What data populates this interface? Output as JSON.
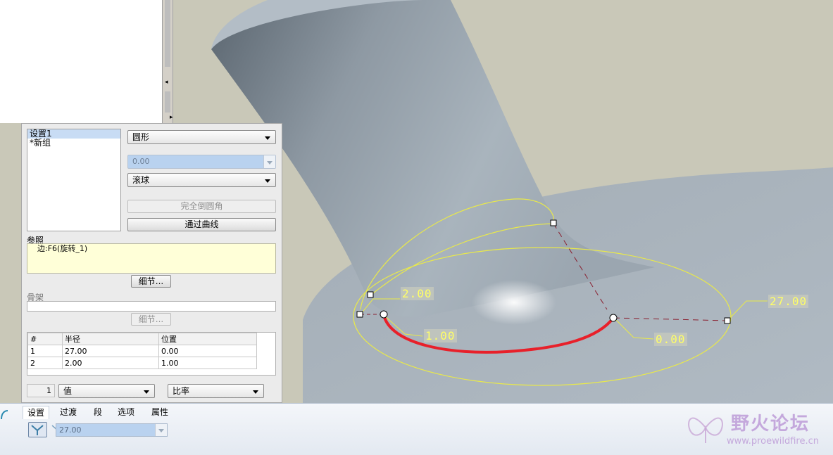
{
  "sets_list": {
    "items": [
      "设置1",
      "*新组"
    ],
    "selected_index": 0
  },
  "shape_combo": {
    "value": "圆形"
  },
  "value_combo": {
    "value": "0.00"
  },
  "method_combo": {
    "value": "滚球"
  },
  "full_round_button": {
    "label": "完全倒圆角"
  },
  "through_curve_button": {
    "label": "通过曲线"
  },
  "references": {
    "title": "参照",
    "item": "边:F6(旋转_1)",
    "details_label": "细节..."
  },
  "skeleton": {
    "title": "骨架",
    "details_label": "细节..."
  },
  "radius_table": {
    "headers": [
      "#",
      "半径",
      "位置"
    ],
    "rows": [
      [
        "1",
        "27.00",
        "0.00"
      ],
      [
        "2",
        "2.00",
        "1.00"
      ]
    ]
  },
  "bottom_controls": {
    "index_value": "1",
    "type_combo": "值",
    "ratio_combo": "比率"
  },
  "tabs": [
    "设置",
    "过渡",
    "段",
    "选项",
    "属性"
  ],
  "active_tab": "设置",
  "radius_field": {
    "value": "27.00"
  },
  "dimension_labels": [
    "2.00",
    "1.00",
    "0.00",
    "27.00"
  ],
  "watermark": {
    "title": "野火论坛",
    "url": "www.proewildfire.cn"
  },
  "colors": {
    "background": "#c9c8b8",
    "model": "#a9b3bc",
    "highlight_curve": "#e8202a",
    "guide_curve": "#e9e94a",
    "dimension_text": "#ffff66"
  }
}
